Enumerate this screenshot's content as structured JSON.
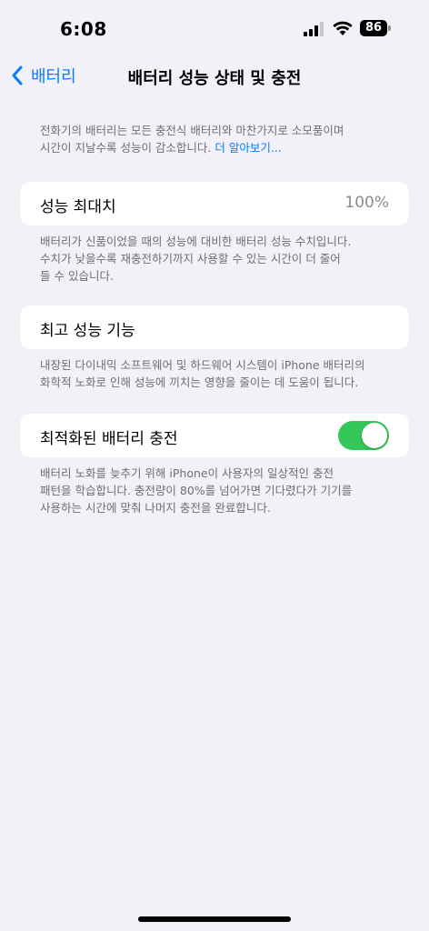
{
  "status_bar": {
    "time": "6:08",
    "battery_level": "86",
    "icons": [
      "cellular-signal-icon",
      "wifi-icon",
      "battery-icon"
    ]
  },
  "nav": {
    "back_label": "배터리",
    "title": "배터리 성능 상태 및 충전"
  },
  "intro": {
    "line1": "전화기의 배터리는 모든 충전식 배터리와 마찬가지로 소모품이며",
    "line2": "시간이 지날수록 성능이 감소합니다.",
    "link": "더 알아보기..."
  },
  "max_capacity": {
    "label": "성능 최대치",
    "value": "100%",
    "footnote_line1": "배터리가 신품이었을 때의 성능에 대비한 배터리 성능 수치입니다.",
    "footnote_line2": "수치가 낮을수록 재충전하기까지 사용할 수 있는 시간이 더 줄어",
    "footnote_line3": "들 수 있습니다."
  },
  "peak_performance": {
    "label": "최고 성능 기능",
    "footnote_line1": "내장된 다이내믹 소프트웨어 및 하드웨어 시스템이 iPhone 배터리의",
    "footnote_line2": "화학적 노화로 인해 성능에 끼치는 영향을 줄이는 데 도움이 됩니다."
  },
  "optimized_charging": {
    "label": "최적화된 배터리 충전",
    "enabled": true,
    "footnote_line1": "배터리 노화를 늦추기 위해 iPhone이 사용자의 일상적인 충전",
    "footnote_line2": "패턴을 학습합니다. 충전량이 80%를 넘어가면 기다렸다가 기기를",
    "footnote_line3": "사용하는 시간에 맞춰 나머지 충전을 완료합니다."
  },
  "colors": {
    "accent": "#0a7aff",
    "toggle_on": "#34c759",
    "background": "#f2f1f7"
  }
}
